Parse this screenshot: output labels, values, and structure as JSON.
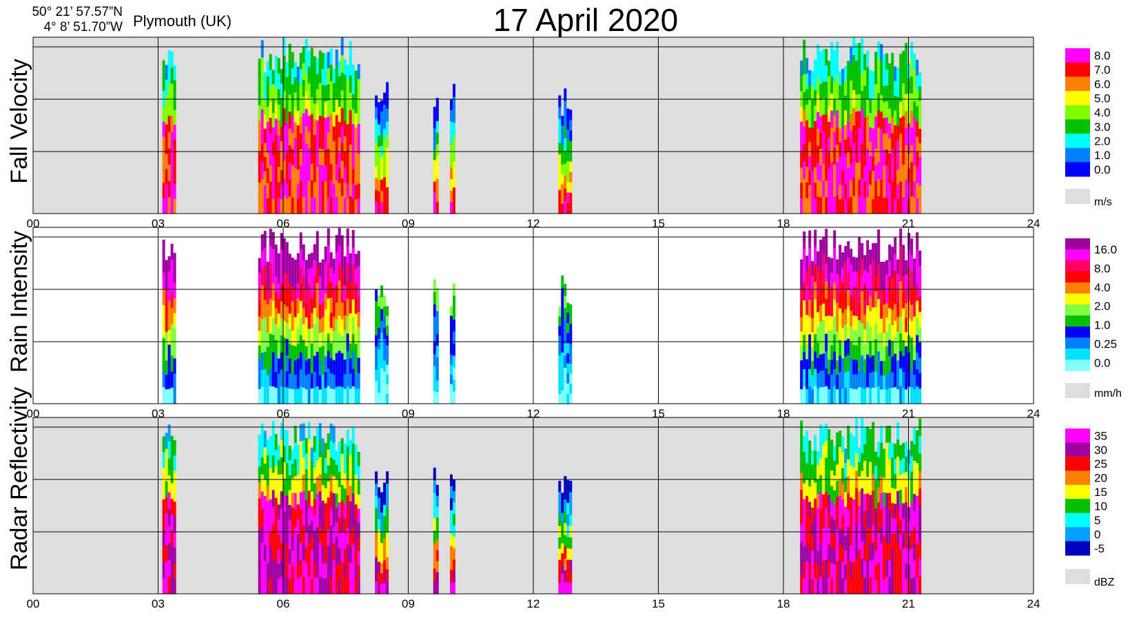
{
  "header": {
    "latitude": "50° 21’ 57.57”N",
    "longitude": "4°  8’ 51.70”W",
    "location": "Plymouth (UK)",
    "title": "17 April 2020"
  },
  "colors": {
    "background": "#dedede",
    "grid": "#000000"
  },
  "chart_data": [
    {
      "type": "heatmap",
      "ylabel": "Fall Velocity",
      "x_ticks": [
        "00",
        "03",
        "06",
        "09",
        "12",
        "15",
        "18",
        "21",
        "24"
      ],
      "xlim": [
        0,
        24
      ],
      "background": "gray",
      "legend": {
        "unit": "m/s",
        "placement": "right",
        "labels": [
          "8.0",
          "7.0",
          "6.0",
          "5.0",
          "4.0",
          "3.0",
          "2.0",
          "1.0",
          "0.0"
        ],
        "colors": [
          "#ff00ff",
          "#ff0000",
          "#ff8000",
          "#ffff00",
          "#80ff00",
          "#00c000",
          "#00ffff",
          "#0080ff",
          "#0000ff"
        ]
      },
      "rain_events": [
        {
          "start": 3.1,
          "end": 3.4,
          "intensity": "high"
        },
        {
          "start": 5.4,
          "end": 7.8,
          "intensity": "high"
        },
        {
          "start": 8.2,
          "end": 8.5,
          "intensity": "low"
        },
        {
          "start": 9.6,
          "end": 9.7,
          "intensity": "low"
        },
        {
          "start": 10.0,
          "end": 10.1,
          "intensity": "low"
        },
        {
          "start": 12.6,
          "end": 12.9,
          "intensity": "low"
        },
        {
          "start": 18.4,
          "end": 21.3,
          "intensity": "high"
        }
      ]
    },
    {
      "type": "heatmap",
      "ylabel": "Rain Intensity",
      "x_ticks": [
        "00",
        "03",
        "06",
        "09",
        "12",
        "15",
        "18",
        "21",
        "24"
      ],
      "xlim": [
        0,
        24
      ],
      "background": "white",
      "legend": {
        "unit": "mm/h",
        "placement": "right",
        "labels": [
          "16.0",
          "8.0",
          "4.0",
          "2.0",
          "1.0",
          "0.25",
          "0.0"
        ],
        "colors": [
          "#a000a0",
          "#ff00ff",
          "#ff0060",
          "#ff0000",
          "#ff8000",
          "#ffff00",
          "#80ff40",
          "#00c000",
          "#0000ff",
          "#0080ff",
          "#00e0ff",
          "#80ffff"
        ]
      },
      "rain_events": [
        {
          "start": 3.1,
          "end": 3.4,
          "intensity": "high"
        },
        {
          "start": 5.4,
          "end": 7.8,
          "intensity": "high"
        },
        {
          "start": 8.2,
          "end": 8.5,
          "intensity": "low"
        },
        {
          "start": 9.6,
          "end": 9.7,
          "intensity": "low"
        },
        {
          "start": 10.0,
          "end": 10.1,
          "intensity": "low"
        },
        {
          "start": 12.6,
          "end": 12.9,
          "intensity": "low"
        },
        {
          "start": 18.4,
          "end": 21.3,
          "intensity": "high"
        }
      ]
    },
    {
      "type": "heatmap",
      "ylabel": "Radar Reflectivity",
      "x_ticks": [
        "00",
        "03",
        "06",
        "09",
        "12",
        "15",
        "18",
        "21",
        "24"
      ],
      "xlim": [
        0,
        24
      ],
      "background": "gray",
      "legend": {
        "unit": "dBZ",
        "placement": "right",
        "labels": [
          "35",
          "30",
          "25",
          "20",
          "15",
          "10",
          "5",
          "0",
          "-5"
        ],
        "colors": [
          "#ff00ff",
          "#a000a0",
          "#ff0000",
          "#ff8000",
          "#ffff00",
          "#00c000",
          "#00ffff",
          "#00a0ff",
          "#0000c0"
        ]
      },
      "rain_events": [
        {
          "start": 3.1,
          "end": 3.4,
          "intensity": "high"
        },
        {
          "start": 5.4,
          "end": 7.8,
          "intensity": "high"
        },
        {
          "start": 8.2,
          "end": 8.5,
          "intensity": "low"
        },
        {
          "start": 9.6,
          "end": 9.7,
          "intensity": "low"
        },
        {
          "start": 10.0,
          "end": 10.1,
          "intensity": "low"
        },
        {
          "start": 12.6,
          "end": 12.9,
          "intensity": "low"
        },
        {
          "start": 18.4,
          "end": 21.3,
          "intensity": "high"
        }
      ]
    }
  ]
}
